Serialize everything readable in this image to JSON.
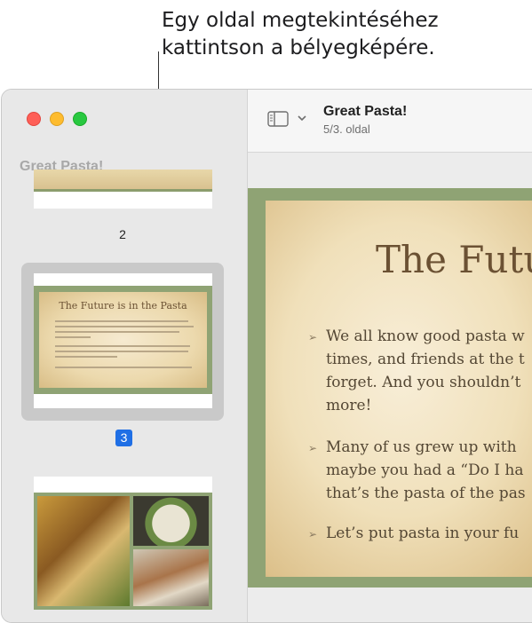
{
  "callout": {
    "line1": "Egy oldal megtekintéséhez",
    "line2": "kattintson a bélyegképére."
  },
  "sidebar": {
    "title": "Great Pasta!",
    "page_labels": [
      "2",
      "3"
    ],
    "selected_page": "3",
    "thumb_slide": {
      "title": "The Future is in the Pasta"
    }
  },
  "toolbar": {
    "doc_title": "Great Pasta!",
    "page_status": "5/3. oldal",
    "icons": [
      "sidebar-toggle-icon",
      "chevron-down-icon"
    ]
  },
  "slide": {
    "title": "The Futu",
    "bullets": [
      [
        "We all know good pasta w",
        "times, and friends at the t",
        "forget. And you shouldn’t",
        "more!"
      ],
      [
        "Many of us grew up with",
        "maybe you had a “Do I ha",
        "that’s the pasta of the pas"
      ],
      [
        "Let’s put pasta in your fu"
      ]
    ]
  },
  "colors": {
    "accent": "#1f6fe5",
    "close": "#fe5f57",
    "minimize": "#febc2e",
    "maximize": "#28c840"
  }
}
